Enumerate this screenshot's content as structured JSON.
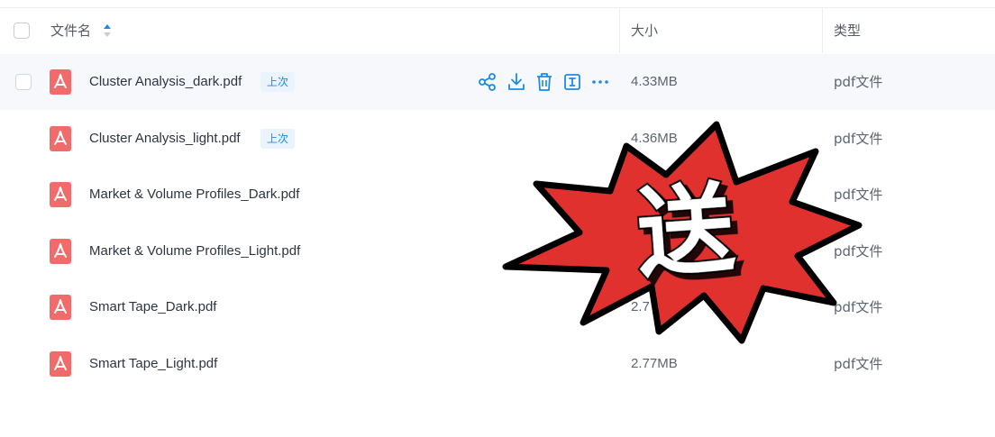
{
  "header": {
    "select_all_label": "",
    "name_col": "文件名",
    "size_col": "大小",
    "type_col": "类型",
    "sort_icon": "sort-asc-icon"
  },
  "rows": [
    {
      "name": "Cluster Analysis_dark.pdf",
      "badge": "上次",
      "size": "4.33MB",
      "type": "pdf文件"
    },
    {
      "name": "Cluster Analysis_light.pdf",
      "badge": "上次",
      "size": "4.36MB",
      "type": "pdf文件"
    },
    {
      "name": "Market & Volume Profiles_Dark.pdf",
      "size": "",
      "type": "pdf文件"
    },
    {
      "name": "Market & Volume Profiles_Light.pdf",
      "size": "",
      "type": "pdf文件"
    },
    {
      "name": "Smart Tape_Dark.pdf",
      "size": "2.7",
      "type": "pdf文件"
    },
    {
      "name": "Smart Tape_Light.pdf",
      "size": "2.77MB",
      "type": "pdf文件"
    }
  ],
  "row_actions": [
    "share-icon",
    "download-icon",
    "delete-icon",
    "rename-icon",
    "more-icon"
  ],
  "sticker": {
    "text": "送"
  },
  "colors": {
    "accent": "#1e8ae6",
    "pdf_icon": "#f26b6b",
    "sticker_red": "#e0312f",
    "hover_row": "#f6f8fb"
  }
}
